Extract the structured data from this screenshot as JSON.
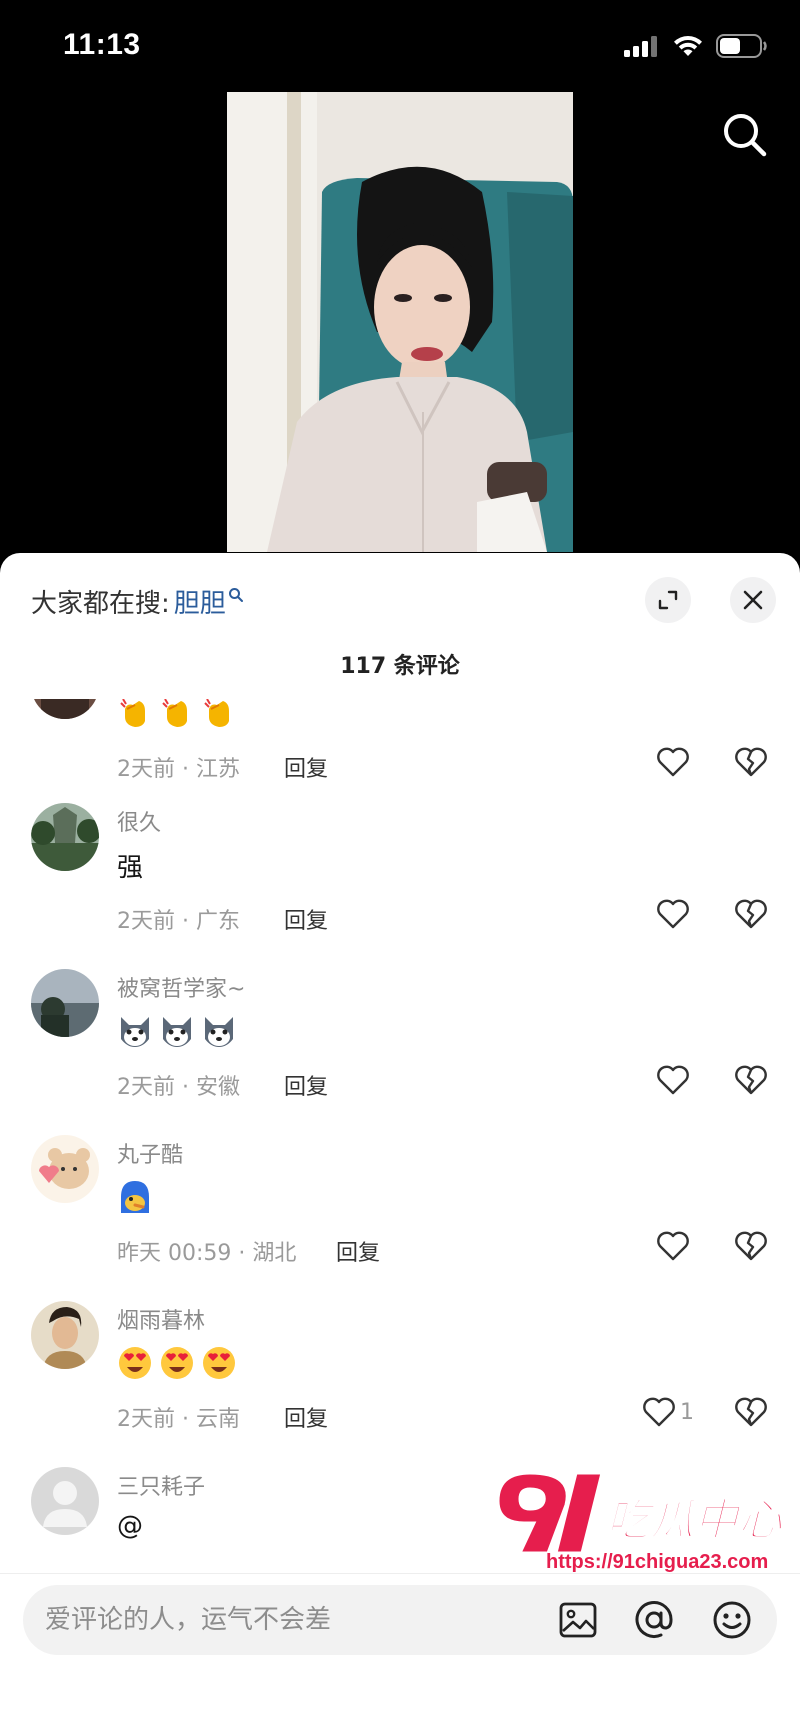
{
  "status": {
    "time": "11:13"
  },
  "sheet": {
    "hot_search_label": "大家都在搜:",
    "hot_search_term": "胆胆",
    "comment_count": "117 条评论"
  },
  "comments": [
    {
      "name": "",
      "text": "",
      "meta": "2天前 · 江苏",
      "reply": "回复",
      "likes": "",
      "emojis": [
        "clap-emoji",
        "clap-emoji",
        "clap-emoji"
      ]
    },
    {
      "name": "很久",
      "text": "强",
      "meta": "2天前 · 广东",
      "reply": "回复",
      "likes": "",
      "emojis": []
    },
    {
      "name": "被窝哲学家~",
      "text": "",
      "meta": "2天前 · 安徽",
      "reply": "回复",
      "likes": "",
      "emojis": [
        "husky-emoji",
        "husky-emoji",
        "husky-emoji"
      ]
    },
    {
      "name": "丸子酷",
      "text": "",
      "meta": "昨天 00:59 · 湖北",
      "reply": "回复",
      "likes": "",
      "emojis": [
        "blue-creature-emoji"
      ]
    },
    {
      "name": "烟雨暮林",
      "text": "",
      "meta": "2天前 · 云南",
      "reply": "回复",
      "likes": "1",
      "emojis": [
        "heart-eyes-emoji",
        "heart-eyes-emoji",
        "heart-eyes-emoji"
      ]
    },
    {
      "name": "三只耗子",
      "text": "@",
      "meta": "",
      "reply": "",
      "likes": "",
      "emojis": []
    }
  ],
  "input": {
    "placeholder": "爱评论的人，运气不会差"
  },
  "watermark": {
    "brand": "91吃瓜中心",
    "url": "https://91chigua23.com"
  },
  "colors": {
    "accent_link": "#2b5c9b",
    "watermark_red": "#e61e4d"
  }
}
